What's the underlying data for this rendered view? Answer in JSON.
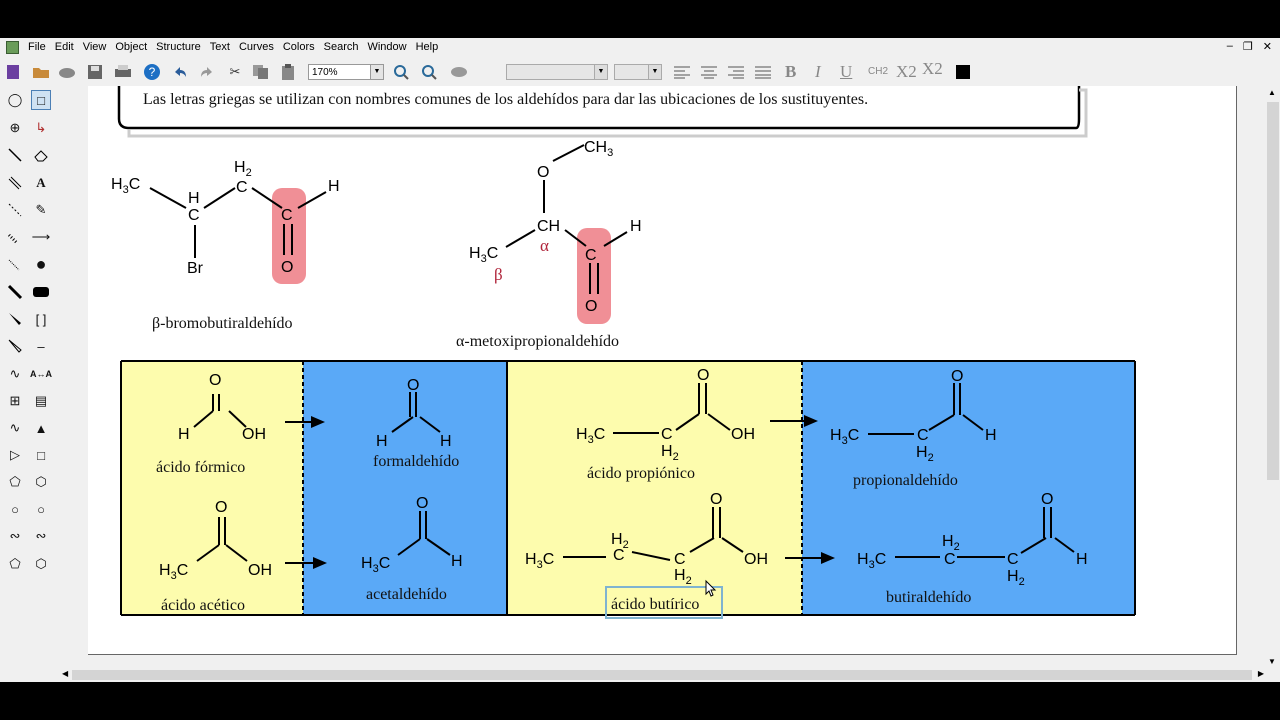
{
  "menu": [
    "File",
    "Edit",
    "View",
    "Object",
    "Structure",
    "Text",
    "Curves",
    "Colors",
    "Search",
    "Window",
    "Help"
  ],
  "toolbar": {
    "zoom": "170%",
    "bold": "B",
    "italic": "I",
    "underline": "U",
    "ch2": "CH2",
    "subscript": "X2",
    "superscript": "X2"
  },
  "note": "Las letras griegas se utilizan con nombres comunes de los aldehídos para dar las ubicaciones de los sustituyentes.",
  "examples": {
    "beta_name": "β-bromobutiraldehído",
    "alpha_name": "α-metoxipropionaldehído",
    "alpha": "α",
    "beta": "β"
  },
  "table": {
    "left_panel": [
      "ácido fórmico",
      "ácido acético"
    ],
    "left_products": [
      "formaldehído",
      "acetaldehído"
    ],
    "right_panel": [
      "ácido propiónico",
      "ácido butírico"
    ],
    "right_products": [
      "propionaldehído",
      "butiraldehído"
    ]
  },
  "colors": {
    "yellow": "#fdfcad",
    "blue": "#5aa9f7",
    "highlight": "#f08f96",
    "greek": "#b0253b"
  }
}
